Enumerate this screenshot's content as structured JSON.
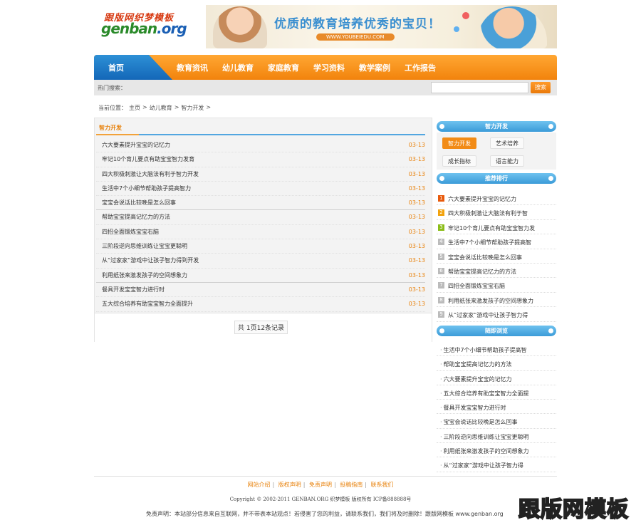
{
  "logo": {
    "cn": "跟版网织梦模板",
    "en_a": "genban",
    "en_b": ".org"
  },
  "banner": {
    "slogan": "优质的教育培养优秀的宝贝！",
    "url": "WWW.YOUBEIEDU.COM"
  },
  "nav": {
    "home": "首页",
    "items": [
      "教育资讯",
      "幼儿教育",
      "家庭教育",
      "学习资料",
      "教学案例",
      "工作报告"
    ]
  },
  "search": {
    "hot_label": "热门搜索：",
    "button": "搜索",
    "placeholder": ""
  },
  "breadcrumb": [
    "当前位置：",
    "主页",
    ">",
    "幼儿教育",
    ">",
    "智力开发",
    ">"
  ],
  "main": {
    "title": "智力开发",
    "articles": [
      {
        "title": "六大要素提升宝宝的记忆力",
        "date": "03-13"
      },
      {
        "title": "牢记10个育儿要点有助宝宝智力发育",
        "date": "03-13"
      },
      {
        "title": "四大积极刺激让大脑法有利于智力开发",
        "date": "03-13"
      },
      {
        "title": "生活中7个小细节帮助孩子提高智力",
        "date": "03-13"
      },
      {
        "title": "宝宝会说话比较晚是怎么回事",
        "date": "03-13"
      },
      {
        "title": "帮助宝宝提高记忆力的方法",
        "date": "03-13"
      },
      {
        "title": "四招全面锻炼宝宝右脑",
        "date": "03-13"
      },
      {
        "title": "三阶段逆向思维训练让宝宝更聪明",
        "date": "03-13"
      },
      {
        "title": "从“过家家”游戏中让孩子智力得到开发",
        "date": "03-13"
      },
      {
        "title": "利用纸张来激发孩子的空间想象力",
        "date": "03-13"
      },
      {
        "title": "餐具开发宝宝智力进行时",
        "date": "03-13"
      },
      {
        "title": "五大综合培养有助宝宝智力全面提升",
        "date": "03-13"
      }
    ],
    "pager": "共 1页12条记录"
  },
  "right": {
    "cat_title": "智力开发",
    "tags": [
      "智力开发",
      "艺术培养",
      "成长指标",
      "语言能力"
    ],
    "rank_title": "推荐排行",
    "rank": [
      "六大要素提升宝宝的记忆力",
      "四大积极刺激让大脑法有利于智",
      "牢记10个育儿要点有助宝宝智力发",
      "生活中7个小细节帮助孩子提高智",
      "宝宝会说话比较晚是怎么回事",
      "帮助宝宝提高记忆力的方法",
      "四招全面锻炼宝宝右脑",
      "利用纸张来激发孩子的空间想象力",
      "从“过家家”游戏中让孩子智力得"
    ],
    "rand_title": "随即浏览",
    "rand": [
      "生活中7个小细节帮助孩子提高智",
      "帮助宝宝提高记忆力的方法",
      "六大要素提升宝宝的记忆力",
      "五大综合培养有助宝宝智力全面提",
      "餐具开发宝宝智力进行时",
      "宝宝会说话比较晚是怎么回事",
      "三阶段逆向思维训练让宝宝更聪明",
      "利用纸张来激发孩子的空间想象力",
      "从“过家家”游戏中让孩子智力得"
    ]
  },
  "footer": {
    "links": [
      "网站介绍",
      "版权声明",
      "免责声明",
      "投稿指南",
      "联系我们"
    ],
    "separator": "|",
    "copyright": "Copyright © 2002-2011 GENBAN.ORG 织梦模板 版权所有 ICP备888888号",
    "disclaimer": "免责声明：本站部分信息来自互联网，并不带表本站观点！若侵害了您的利益，请联系我们，我们将及时删除！跟版网模板 www.genban.org",
    "watermark": "跟版网模板"
  },
  "colors": {
    "orange": "#f2830c",
    "blue": "#1467b8",
    "light_blue": "#3b9bd8"
  }
}
